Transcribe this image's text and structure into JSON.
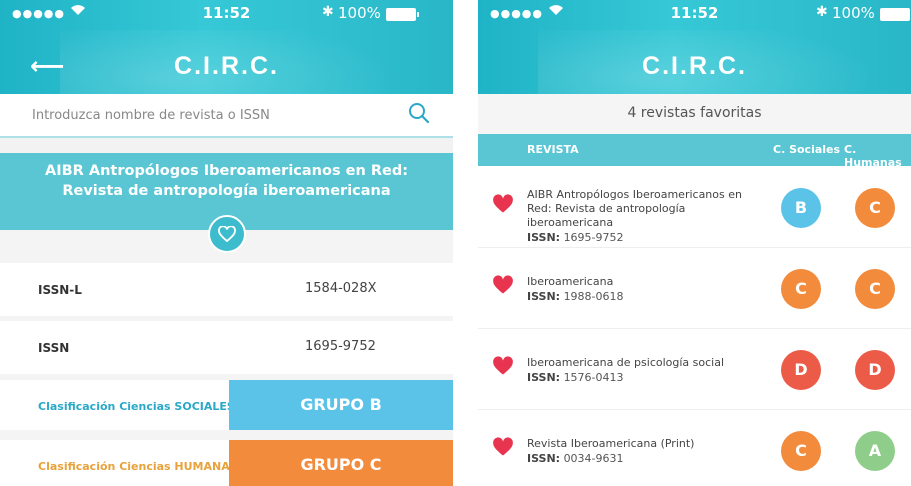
{
  "status": {
    "time": "11:52",
    "battery": "100%"
  },
  "app_title": "C.I.R.C.",
  "left": {
    "search_placeholder": "Introduzca nombre de revista o ISSN",
    "journal_title": "AIBR Antropólogos Iberoamericanos en Red: Revista de antropología iberoamericana",
    "details": [
      {
        "label": "ISSN-L",
        "value": "1584-028X"
      },
      {
        "label": "ISSN",
        "value": "1695-9752"
      }
    ],
    "classifications": [
      {
        "label": "Clasificación Ciencias SOCIALES",
        "group": "GRUPO B",
        "label_color": "#2aa8c8",
        "group_color": "#5bc3e8"
      },
      {
        "label": "Clasificación Ciencias HUMANAS",
        "group": "GRUPO C",
        "label_color": "#e8a23a",
        "group_color": "#f28b3c"
      }
    ]
  },
  "right": {
    "fav_count": "4 revistas favoritas",
    "headers": {
      "journal": "REVISTA",
      "social": "C. Sociales",
      "humanities": "C. Humanas"
    },
    "issn_label": "ISSN:",
    "rows": [
      {
        "name": "AIBR Antropólogos Iberoamericanos en Red: Revista de antropología iberoamericana",
        "issn": "1695-9752",
        "social": "B",
        "humanities": "C"
      },
      {
        "name": "Iberoamericana",
        "issn": "1988-0618",
        "social": "C",
        "humanities": "C"
      },
      {
        "name": "Iberoamericana de psicología social",
        "issn": "1576-0413",
        "social": "D",
        "humanities": "D"
      },
      {
        "name": "Revista Iberoamericana (Print)",
        "issn": "0034-9631",
        "social": "C",
        "humanities": "A"
      }
    ]
  },
  "colors": {
    "header": "#2fbfd0",
    "accent": "#5ac6d4",
    "heart": "#e8344e",
    "grade": {
      "A": "#8fce8a",
      "B": "#5bc3e8",
      "C": "#f28b3c",
      "D": "#ec5b48"
    }
  }
}
